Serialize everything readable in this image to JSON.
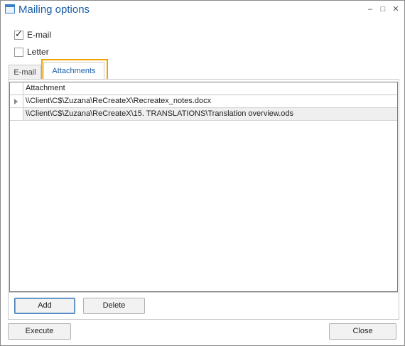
{
  "window": {
    "title": "Mailing options",
    "controls": {
      "minimize": "–",
      "restore": "□",
      "close": "✕"
    }
  },
  "checkboxes": [
    {
      "label": "E-mail",
      "checked": true
    },
    {
      "label": "Letter",
      "checked": false
    }
  ],
  "tabs": [
    {
      "label": "E-mail",
      "active": false
    },
    {
      "label": "Attachments",
      "active": true
    }
  ],
  "grid": {
    "header": "Attachment",
    "rows": [
      {
        "path": "\\\\Client\\C$\\Zuzana\\ReCreateX\\Recreatex_notes.docx",
        "current": true
      },
      {
        "path": "\\\\Client\\C$\\Zuzana\\ReCreateX\\15. TRANSLATIONS\\Translation overview.ods",
        "current": false
      }
    ]
  },
  "panel_buttons": {
    "add": "Add",
    "delete": "Delete"
  },
  "footer_buttons": {
    "execute": "Execute",
    "close": "Close"
  },
  "colors": {
    "accent": "#1a5ea8",
    "highlight": "#f0a400"
  }
}
